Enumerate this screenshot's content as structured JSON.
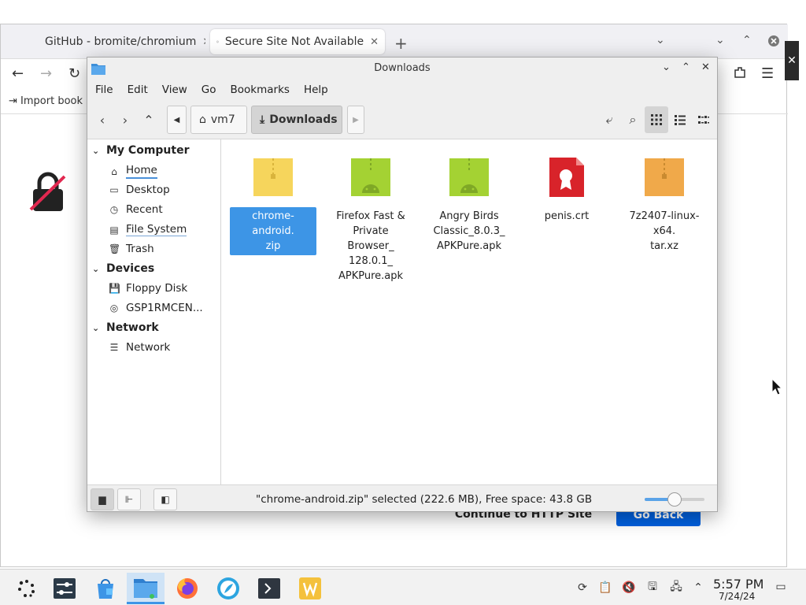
{
  "browser": {
    "tabs": [
      {
        "label": "GitHub - bromite/chromium"
      },
      {
        "label": "Secure Site Not Available"
      }
    ],
    "bookmarks_label": "Import book",
    "continue_label": "Continue to HTTP Site",
    "goback_label": "Go Back",
    "close_glyph": "✕"
  },
  "fm": {
    "title": "Downloads",
    "menu": [
      "File",
      "Edit",
      "View",
      "Go",
      "Bookmarks",
      "Help"
    ],
    "breadcrumb": {
      "home": "vm7",
      "current": "Downloads"
    },
    "sidebar": {
      "my_computer": {
        "header": "My Computer",
        "items": [
          {
            "label": "Home",
            "icon": "home-icon"
          },
          {
            "label": "Desktop",
            "icon": "desktop-icon"
          },
          {
            "label": "Recent",
            "icon": "recent-icon"
          },
          {
            "label": "File System",
            "icon": "drive-icon"
          },
          {
            "label": "Trash",
            "icon": "trash-icon"
          }
        ]
      },
      "devices": {
        "header": "Devices",
        "items": [
          {
            "label": "Floppy Disk",
            "icon": "floppy-icon"
          },
          {
            "label": "GSP1RMCEN...",
            "icon": "disc-icon"
          }
        ]
      },
      "network": {
        "header": "Network",
        "items": [
          {
            "label": "Network",
            "icon": "network-icon"
          }
        ]
      }
    },
    "files": [
      {
        "name": "chrome-android.\nzip",
        "type": "zip",
        "color": "#f6d55c",
        "selected": true
      },
      {
        "name": "Firefox Fast &\nPrivate Browser_\n128.0.1_\nAPKPure.apk",
        "type": "apk",
        "color": "#a4d233"
      },
      {
        "name": "Angry Birds\nClassic_8.0.3_\nAPKPure.apk",
        "type": "apk",
        "color": "#a4d233"
      },
      {
        "name": "penis.crt",
        "type": "crt",
        "color": "#d8232a"
      },
      {
        "name": "7z2407-linux-x64.\ntar.xz",
        "type": "xz",
        "color": "#f0a94a"
      }
    ],
    "status": "\"chrome-android.zip\" selected (222.6 MB), Free space: 43.8 GB",
    "zoom_level": 0.5
  },
  "taskbar": {
    "time": "5:57 PM",
    "date": "7/24/24"
  }
}
